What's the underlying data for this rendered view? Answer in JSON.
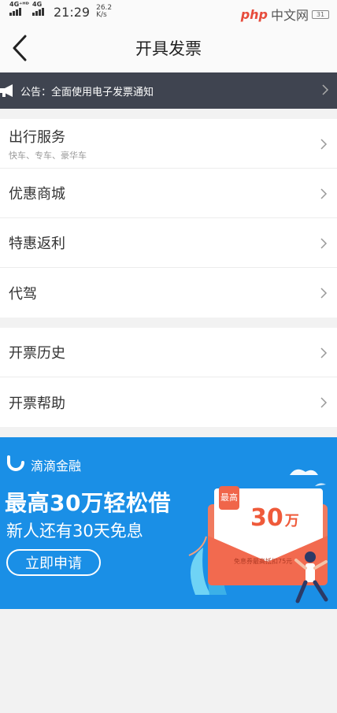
{
  "status_bar": {
    "network_1": "4G⁺ᴴᴰ",
    "network_2": "4G",
    "time": "21:29",
    "speed_value": "26.2",
    "speed_unit": "K/s",
    "watermark_php": "php",
    "watermark_cn": "中文网",
    "battery": "31"
  },
  "nav": {
    "title": "开具发票"
  },
  "notice": {
    "text": "公告：全面使用电子发票通知"
  },
  "group1": [
    {
      "title": "出行服务",
      "subtitle": "快车、专车、豪华车"
    },
    {
      "title": "优惠商城",
      "subtitle": ""
    },
    {
      "title": "特惠返利",
      "subtitle": ""
    },
    {
      "title": "代驾",
      "subtitle": ""
    }
  ],
  "group2": [
    {
      "title": "开票历史"
    },
    {
      "title": "开票帮助"
    }
  ],
  "banner": {
    "brand": "滴滴金融",
    "headline": "最高30万轻松借",
    "subline": "新人还有30天免息",
    "button": "立即申请",
    "card_tag": "最高",
    "card_amount": "30",
    "card_unit": "万",
    "card_note": "免息券最高抵扣75元",
    "colors": {
      "background": "#1a8fe6",
      "card_red": "#ef5a3a"
    }
  }
}
